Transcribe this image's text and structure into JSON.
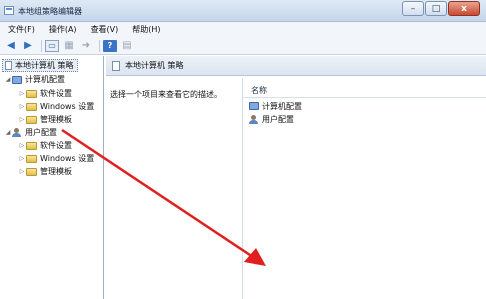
{
  "window": {
    "title": "本地组策略编辑器",
    "min_glyph": "–",
    "max_glyph": "□",
    "close_glyph": "x"
  },
  "menu": [
    "文件(F)",
    "操作(A)",
    "查看(V)",
    "帮助(H)"
  ],
  "toolbar": {
    "icons": [
      "back-arrow-icon",
      "forward-arrow-icon",
      "folder-icon",
      "grid-icon",
      "export-icon",
      "help-icon",
      "properties-icon"
    ],
    "help_glyph": "?"
  },
  "tree": {
    "root": "本地计算机 策略",
    "computer": {
      "label": "计算机配置",
      "children": [
        "软件设置",
        "Windows 设置",
        "管理模板"
      ]
    },
    "user": {
      "label": "用户配置",
      "children": [
        "软件设置",
        "Windows 设置",
        "管理模板"
      ]
    }
  },
  "content": {
    "header": "本地计算机 策略",
    "description": "选择一个项目来查看它的描述。",
    "column_header": "名称",
    "items": [
      "计算机配置",
      "用户配置"
    ]
  },
  "annotation": {
    "arrow_color": "#e02020"
  },
  "colors": {
    "titlebar": "#c4d6ec",
    "close_button": "#c94a31",
    "folder": "#e2bf4c"
  }
}
